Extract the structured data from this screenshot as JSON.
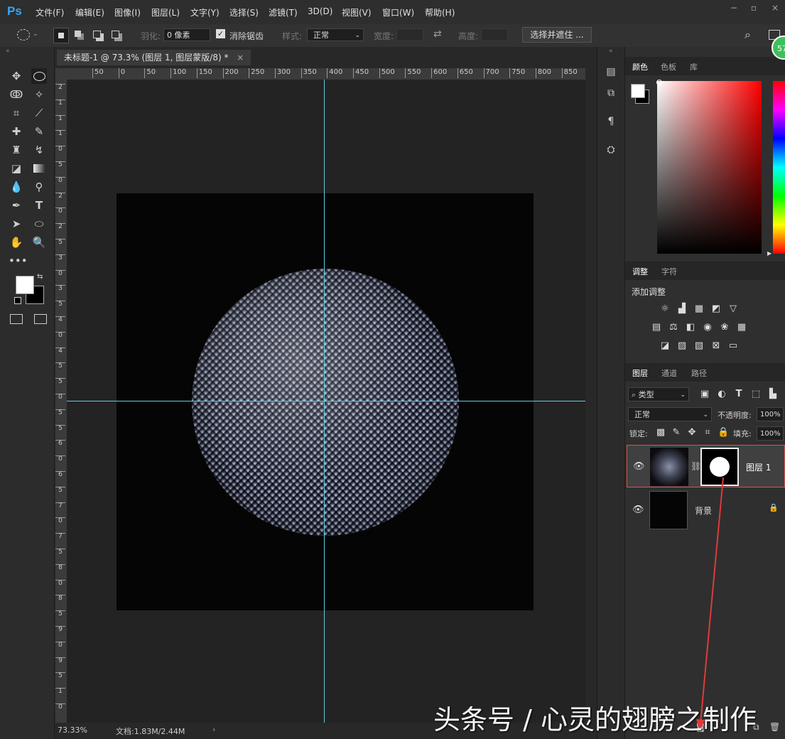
{
  "app": {
    "logo": "Ps"
  },
  "menu": [
    "文件(F)",
    "编辑(E)",
    "图像(I)",
    "图层(L)",
    "文字(Y)",
    "选择(S)",
    "滤镜(T)",
    "3D(D)",
    "视图(V)",
    "窗口(W)",
    "帮助(H)"
  ],
  "options": {
    "feather_label": "羽化:",
    "feather_value": "0 像素",
    "antialias_label": "消除锯齿",
    "style_label": "样式:",
    "style_value": "正常",
    "width_label": "宽度:",
    "height_label": "高度:",
    "select_mask_button": "选择并遮住 ..."
  },
  "document": {
    "tab_title": "未标题-1 @ 73.3% (图层 1, 图层蒙版/8) *",
    "zoom_status": "73.33%",
    "doc_status": "文档:1.83M/2.44M"
  },
  "ruler_h": [
    "50",
    "0",
    "50",
    "100",
    "150",
    "200",
    "250",
    "300",
    "350",
    "400",
    "450",
    "500",
    "550",
    "600",
    "650",
    "700",
    "750",
    "800",
    "850"
  ],
  "ruler_v": [
    "2",
    "1",
    "1",
    "1",
    "0",
    "5",
    "0",
    "2",
    "0",
    "2",
    "5",
    "3",
    "0",
    "3",
    "5",
    "4",
    "0",
    "4",
    "5",
    "5",
    "0",
    "5",
    "5",
    "6",
    "0",
    "6",
    "5",
    "7",
    "0",
    "7",
    "5",
    "8",
    "0",
    "8",
    "5",
    "9",
    "0",
    "9",
    "5",
    "1",
    "0"
  ],
  "panels": {
    "color_tabs": [
      "颜色",
      "色板",
      "库"
    ],
    "adjust_tabs": [
      "调整",
      "字符"
    ],
    "adjust_title": "添加调整",
    "layers_tabs": [
      "图层",
      "通道",
      "路径"
    ],
    "filter_kind": "类型",
    "blend_mode": "正常",
    "opacity_label": "不透明度:",
    "opacity_value": "100%",
    "lock_label": "锁定:",
    "fill_label": "填充:",
    "fill_value": "100%",
    "layers": [
      {
        "name": "图层 1"
      },
      {
        "name": "背景"
      }
    ]
  },
  "badge": "57",
  "watermark": "头条号 / 心灵的翅膀之制作",
  "colors": {
    "guide": "#59d0e0",
    "highlight": "#d9534f",
    "ps_blue": "#31a8ff"
  }
}
